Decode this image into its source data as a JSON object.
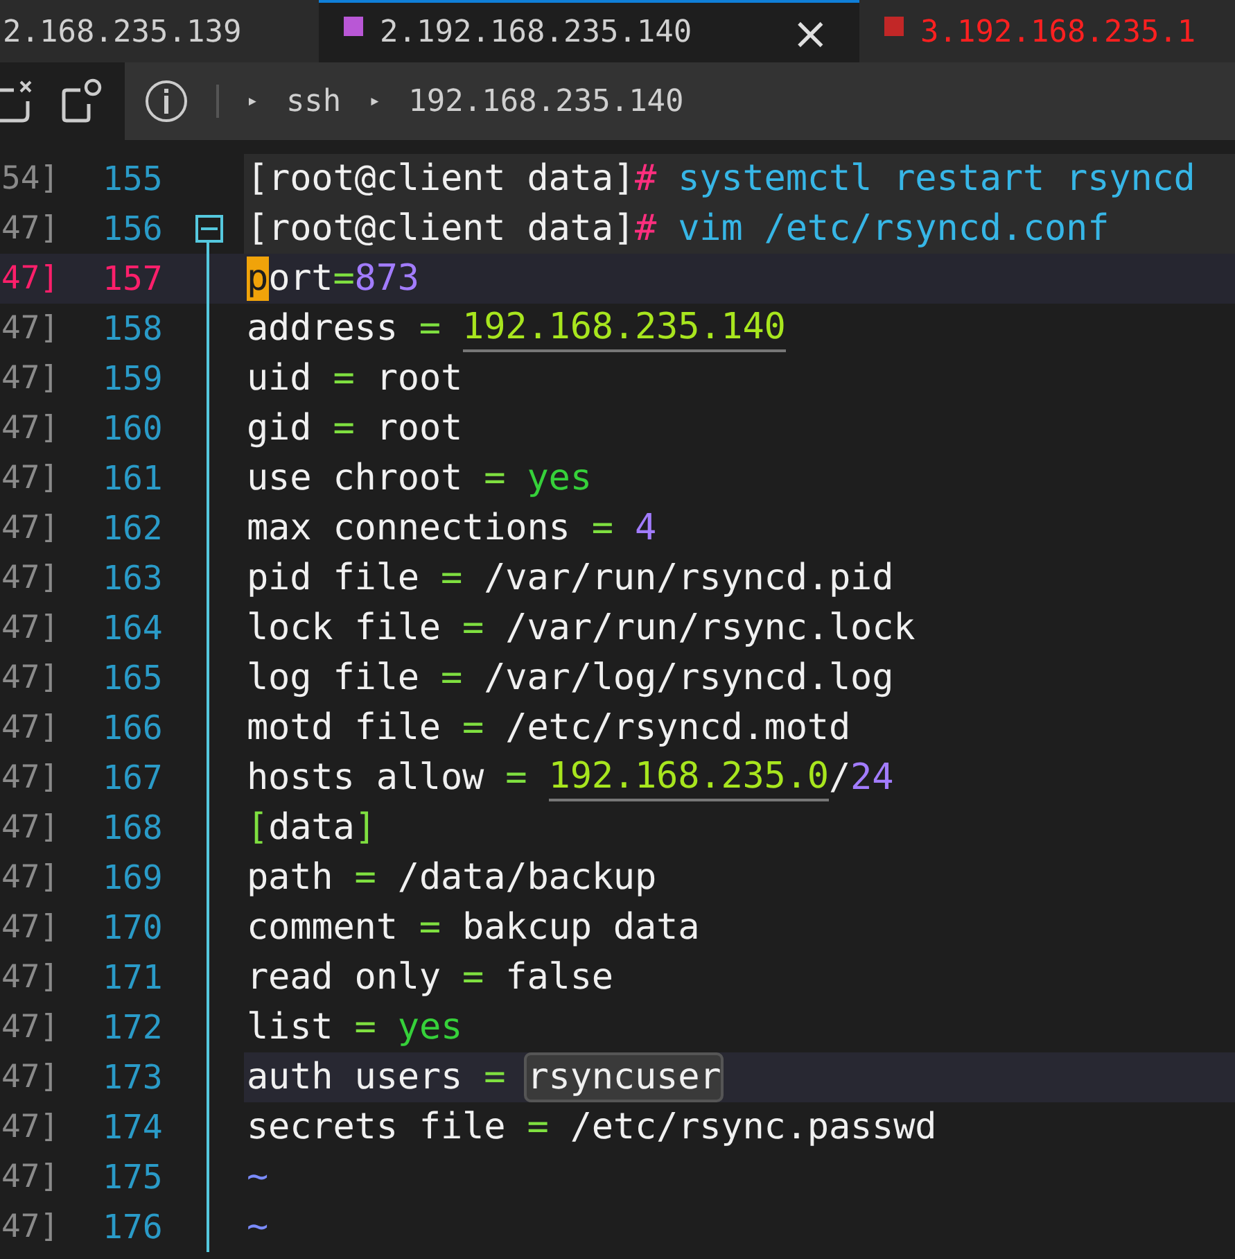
{
  "tabs": [
    {
      "label": "2.168.235.139",
      "selected": false,
      "disconnected": false
    },
    {
      "label": "2.192.168.235.140",
      "selected": true,
      "disconnected": false,
      "color": "#b957d6",
      "close": "×"
    },
    {
      "label": "3.192.168.235.1",
      "selected": false,
      "disconnected": true,
      "color": "#c22727"
    }
  ],
  "breadcrumb": [
    "ssh",
    "192.168.235.140"
  ],
  "breadcrumb_separator": "▸",
  "lines": [
    {
      "stamp": "54]",
      "number": "155",
      "current": false,
      "highlighted": false,
      "shell": true,
      "fold": false,
      "tokens": [
        {
          "kind": "text",
          "text": "[root@client data]"
        },
        {
          "kind": "hash",
          "text": "#"
        },
        {
          "kind": "cmd",
          "text": " systemctl restart rsyncd"
        }
      ]
    },
    {
      "stamp": "47]",
      "number": "156",
      "current": false,
      "highlighted": false,
      "shell": true,
      "fold": true,
      "tokens": [
        {
          "kind": "text",
          "text": "[root@client data]"
        },
        {
          "kind": "hash",
          "text": "#"
        },
        {
          "kind": "cmd",
          "text": " vim /etc/rsyncd.conf"
        }
      ]
    },
    {
      "stamp": "47]",
      "number": "157",
      "current": true,
      "highlighted": false,
      "shell": false,
      "fold": false,
      "tokens": [
        {
          "kind": "cursor",
          "text": "p"
        },
        {
          "kind": "text",
          "text": "ort"
        },
        {
          "kind": "op",
          "text": "="
        },
        {
          "kind": "num",
          "text": "873"
        }
      ]
    },
    {
      "stamp": "47]",
      "number": "158",
      "current": false,
      "highlighted": false,
      "shell": false,
      "fold": false,
      "tokens": [
        {
          "kind": "text",
          "text": "address"
        },
        {
          "kind": "op",
          "text": " = "
        },
        {
          "kind": "ip",
          "text": "192.168.235.140"
        }
      ]
    },
    {
      "stamp": "47]",
      "number": "159",
      "current": false,
      "highlighted": false,
      "shell": false,
      "fold": false,
      "tokens": [
        {
          "kind": "text",
          "text": "uid"
        },
        {
          "kind": "op",
          "text": " = "
        },
        {
          "kind": "text",
          "text": "root"
        }
      ]
    },
    {
      "stamp": "47]",
      "number": "160",
      "current": false,
      "highlighted": false,
      "shell": false,
      "fold": false,
      "tokens": [
        {
          "kind": "text",
          "text": "gid"
        },
        {
          "kind": "op",
          "text": " = "
        },
        {
          "kind": "text",
          "text": "root"
        }
      ]
    },
    {
      "stamp": "47]",
      "number": "161",
      "current": false,
      "highlighted": false,
      "shell": false,
      "fold": false,
      "tokens": [
        {
          "kind": "text",
          "text": "use chroot"
        },
        {
          "kind": "op",
          "text": " = "
        },
        {
          "kind": "bool",
          "text": "yes"
        }
      ]
    },
    {
      "stamp": "47]",
      "number": "162",
      "current": false,
      "highlighted": false,
      "shell": false,
      "fold": false,
      "tokens": [
        {
          "kind": "text",
          "text": "max connections"
        },
        {
          "kind": "op",
          "text": " = "
        },
        {
          "kind": "num",
          "text": "4"
        }
      ]
    },
    {
      "stamp": "47]",
      "number": "163",
      "current": false,
      "highlighted": false,
      "shell": false,
      "fold": false,
      "tokens": [
        {
          "kind": "text",
          "text": "pid file"
        },
        {
          "kind": "op",
          "text": " = "
        },
        {
          "kind": "text",
          "text": "/var/run/rsyncd.pid"
        }
      ]
    },
    {
      "stamp": "47]",
      "number": "164",
      "current": false,
      "highlighted": false,
      "shell": false,
      "fold": false,
      "tokens": [
        {
          "kind": "text",
          "text": "lock file"
        },
        {
          "kind": "op",
          "text": " = "
        },
        {
          "kind": "text",
          "text": "/var/run/rsync.lock"
        }
      ]
    },
    {
      "stamp": "47]",
      "number": "165",
      "current": false,
      "highlighted": false,
      "shell": false,
      "fold": false,
      "tokens": [
        {
          "kind": "text",
          "text": "log file"
        },
        {
          "kind": "op",
          "text": " = "
        },
        {
          "kind": "text",
          "text": "/var/log/rsyncd.log"
        }
      ]
    },
    {
      "stamp": "47]",
      "number": "166",
      "current": false,
      "highlighted": false,
      "shell": false,
      "fold": false,
      "tokens": [
        {
          "kind": "text",
          "text": "motd file"
        },
        {
          "kind": "op",
          "text": " = "
        },
        {
          "kind": "text",
          "text": "/etc/rsyncd.motd"
        }
      ]
    },
    {
      "stamp": "47]",
      "number": "167",
      "current": false,
      "highlighted": false,
      "shell": false,
      "fold": false,
      "tokens": [
        {
          "kind": "text",
          "text": "hosts allow"
        },
        {
          "kind": "op",
          "text": " = "
        },
        {
          "kind": "ip",
          "text": "192.168.235.0"
        },
        {
          "kind": "text",
          "text": "/"
        },
        {
          "kind": "num",
          "text": "24"
        }
      ]
    },
    {
      "stamp": "47]",
      "number": "168",
      "current": false,
      "highlighted": false,
      "shell": false,
      "fold": false,
      "tokens": [
        {
          "kind": "bracket",
          "text": "["
        },
        {
          "kind": "text",
          "text": "data"
        },
        {
          "kind": "bracket",
          "text": "]"
        }
      ]
    },
    {
      "stamp": "47]",
      "number": "169",
      "current": false,
      "highlighted": false,
      "shell": false,
      "fold": false,
      "tokens": [
        {
          "kind": "text",
          "text": "path"
        },
        {
          "kind": "op",
          "text": " = "
        },
        {
          "kind": "text",
          "text": "/data/backup"
        }
      ]
    },
    {
      "stamp": "47]",
      "number": "170",
      "current": false,
      "highlighted": false,
      "shell": false,
      "fold": false,
      "tokens": [
        {
          "kind": "text",
          "text": "comment"
        },
        {
          "kind": "op",
          "text": " = "
        },
        {
          "kind": "text",
          "text": "bakcup data"
        }
      ]
    },
    {
      "stamp": "47]",
      "number": "171",
      "current": false,
      "highlighted": false,
      "shell": false,
      "fold": false,
      "tokens": [
        {
          "kind": "text",
          "text": "read only"
        },
        {
          "kind": "op",
          "text": " = "
        },
        {
          "kind": "text",
          "text": "false"
        }
      ]
    },
    {
      "stamp": "47]",
      "number": "172",
      "current": false,
      "highlighted": false,
      "shell": false,
      "fold": false,
      "tokens": [
        {
          "kind": "text",
          "text": "list"
        },
        {
          "kind": "op",
          "text": " = "
        },
        {
          "kind": "bool",
          "text": "yes"
        }
      ]
    },
    {
      "stamp": "47]",
      "number": "173",
      "current": false,
      "highlighted": true,
      "shell": false,
      "fold": false,
      "tokens": [
        {
          "kind": "text",
          "text": "auth users"
        },
        {
          "kind": "op",
          "text": " = "
        },
        {
          "kind": "match",
          "text": "rsyncuser"
        }
      ]
    },
    {
      "stamp": "47]",
      "number": "174",
      "current": false,
      "highlighted": false,
      "shell": false,
      "fold": false,
      "tokens": [
        {
          "kind": "text",
          "text": "secrets file"
        },
        {
          "kind": "op",
          "text": " = "
        },
        {
          "kind": "text",
          "text": "/etc/rsync.passwd"
        }
      ]
    },
    {
      "stamp": "47]",
      "number": "175",
      "current": false,
      "highlighted": false,
      "shell": false,
      "fold": false,
      "tokens": [
        {
          "kind": "tilde",
          "text": "~"
        }
      ]
    },
    {
      "stamp": "47]",
      "number": "176",
      "current": false,
      "highlighted": false,
      "shell": false,
      "fold": false,
      "tokens": [
        {
          "kind": "tilde",
          "text": "~"
        }
      ]
    }
  ]
}
